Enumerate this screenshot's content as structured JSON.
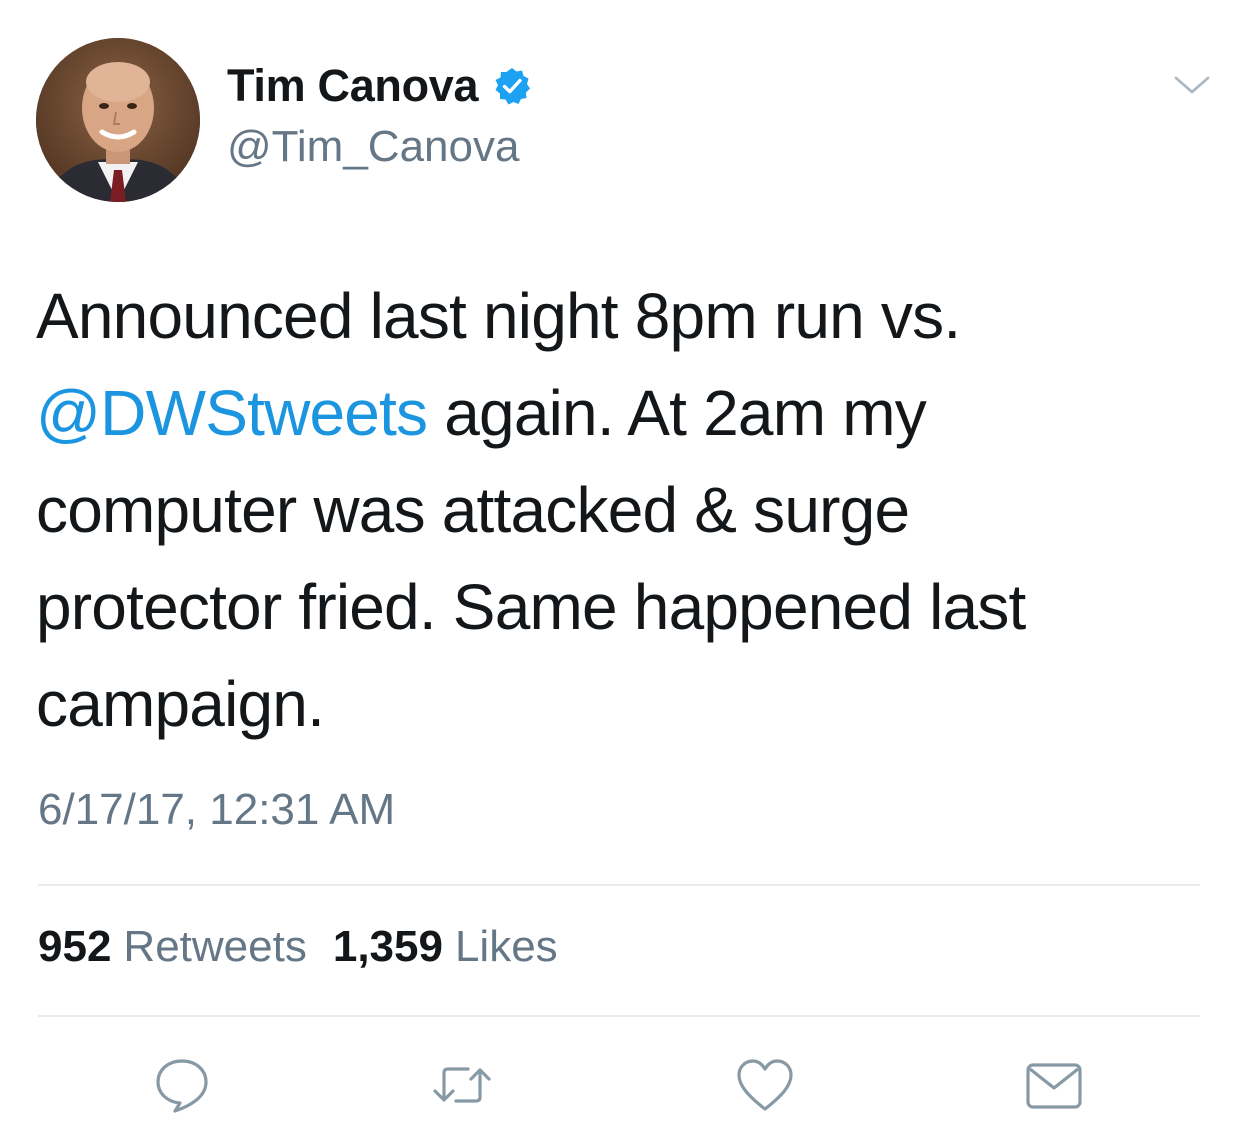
{
  "author": {
    "display_name": "Tim Canova",
    "handle": "@Tim_Canova",
    "verified": true
  },
  "tweet": {
    "lines": [
      {
        "segments": [
          {
            "text": "Announced last night 8pm run vs.",
            "type": "text"
          }
        ]
      },
      {
        "segments": [
          {
            "text": "@DWStweets",
            "type": "mention"
          },
          {
            "text": " again. At 2am my",
            "type": "text"
          }
        ]
      },
      {
        "segments": [
          {
            "text": "computer was attacked & surge",
            "type": "text"
          }
        ]
      },
      {
        "segments": [
          {
            "text": "protector fried. Same happened last",
            "type": "text"
          }
        ]
      },
      {
        "segments": [
          {
            "text": "campaign.",
            "type": "text"
          }
        ]
      }
    ],
    "timestamp": "6/17/17, 12:31 AM"
  },
  "stats": {
    "retweets_count": "952",
    "retweets_label": "Retweets",
    "likes_count": "1,359",
    "likes_label": "Likes"
  },
  "actions": {
    "reply_icon": "reply-icon",
    "retweet_icon": "retweet-icon",
    "like_icon": "heart-icon",
    "dm_icon": "envelope-icon"
  },
  "colors": {
    "link": "#1b95e0",
    "verified_badge": "#1da1f2",
    "secondary_text": "#657786",
    "primary_text": "#14171a",
    "divider": "#e6ecf0"
  }
}
